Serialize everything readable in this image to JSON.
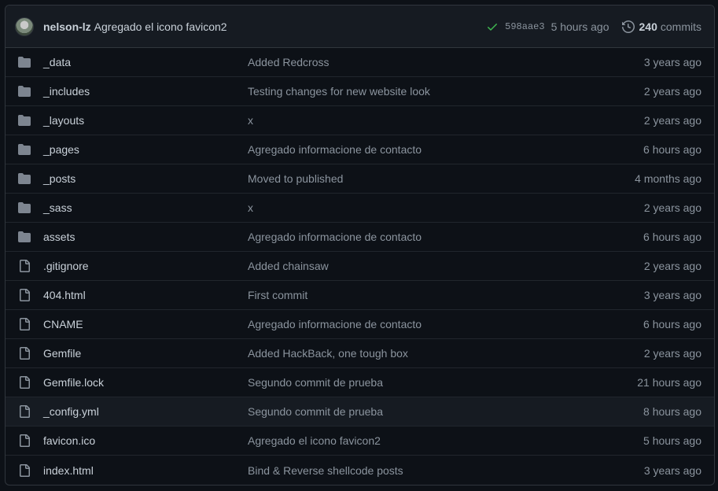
{
  "header": {
    "author": "nelson-lz",
    "message": "Agregado el icono favicon2",
    "sha": "598aae3",
    "time": "5 hours ago",
    "commit_count": "240",
    "commit_label": "commits"
  },
  "files": [
    {
      "type": "folder",
      "name": "_data",
      "message": "Added Redcross",
      "age": "3 years ago"
    },
    {
      "type": "folder",
      "name": "_includes",
      "message": "Testing changes for new website look",
      "age": "2 years ago"
    },
    {
      "type": "folder",
      "name": "_layouts",
      "message": "x",
      "age": "2 years ago"
    },
    {
      "type": "folder",
      "name": "_pages",
      "message": "Agregado informacione de contacto",
      "age": "6 hours ago"
    },
    {
      "type": "folder",
      "name": "_posts",
      "message": "Moved to published",
      "age": "4 months ago"
    },
    {
      "type": "folder",
      "name": "_sass",
      "message": "x",
      "age": "2 years ago"
    },
    {
      "type": "folder",
      "name": "assets",
      "message": "Agregado informacione de contacto",
      "age": "6 hours ago"
    },
    {
      "type": "file",
      "name": ".gitignore",
      "message": "Added chainsaw",
      "age": "2 years ago"
    },
    {
      "type": "file",
      "name": "404.html",
      "message": "First commit",
      "age": "3 years ago"
    },
    {
      "type": "file",
      "name": "CNAME",
      "message": "Agregado informacione de contacto",
      "age": "6 hours ago"
    },
    {
      "type": "file",
      "name": "Gemfile",
      "message": "Added HackBack, one tough box",
      "age": "2 years ago"
    },
    {
      "type": "file",
      "name": "Gemfile.lock",
      "message": "Segundo commit de prueba",
      "age": "21 hours ago"
    },
    {
      "type": "file",
      "name": "_config.yml",
      "message": "Segundo commit de prueba",
      "age": "8 hours ago"
    },
    {
      "type": "file",
      "name": "favicon.ico",
      "message": "Agregado el icono favicon2",
      "age": "5 hours ago"
    },
    {
      "type": "file",
      "name": "index.html",
      "message": "Bind & Reverse shellcode posts",
      "age": "3 years ago"
    }
  ],
  "colors": {
    "background": "#0d1117",
    "header_bg": "#161b22",
    "border": "#30363d",
    "text": "#c9d1d9",
    "muted": "#8b949e",
    "folder_icon": "#7d8590",
    "success": "#3fb950"
  },
  "icons": {
    "folder": "folder-icon",
    "file": "file-icon",
    "check": "check-icon",
    "history": "history-icon"
  }
}
